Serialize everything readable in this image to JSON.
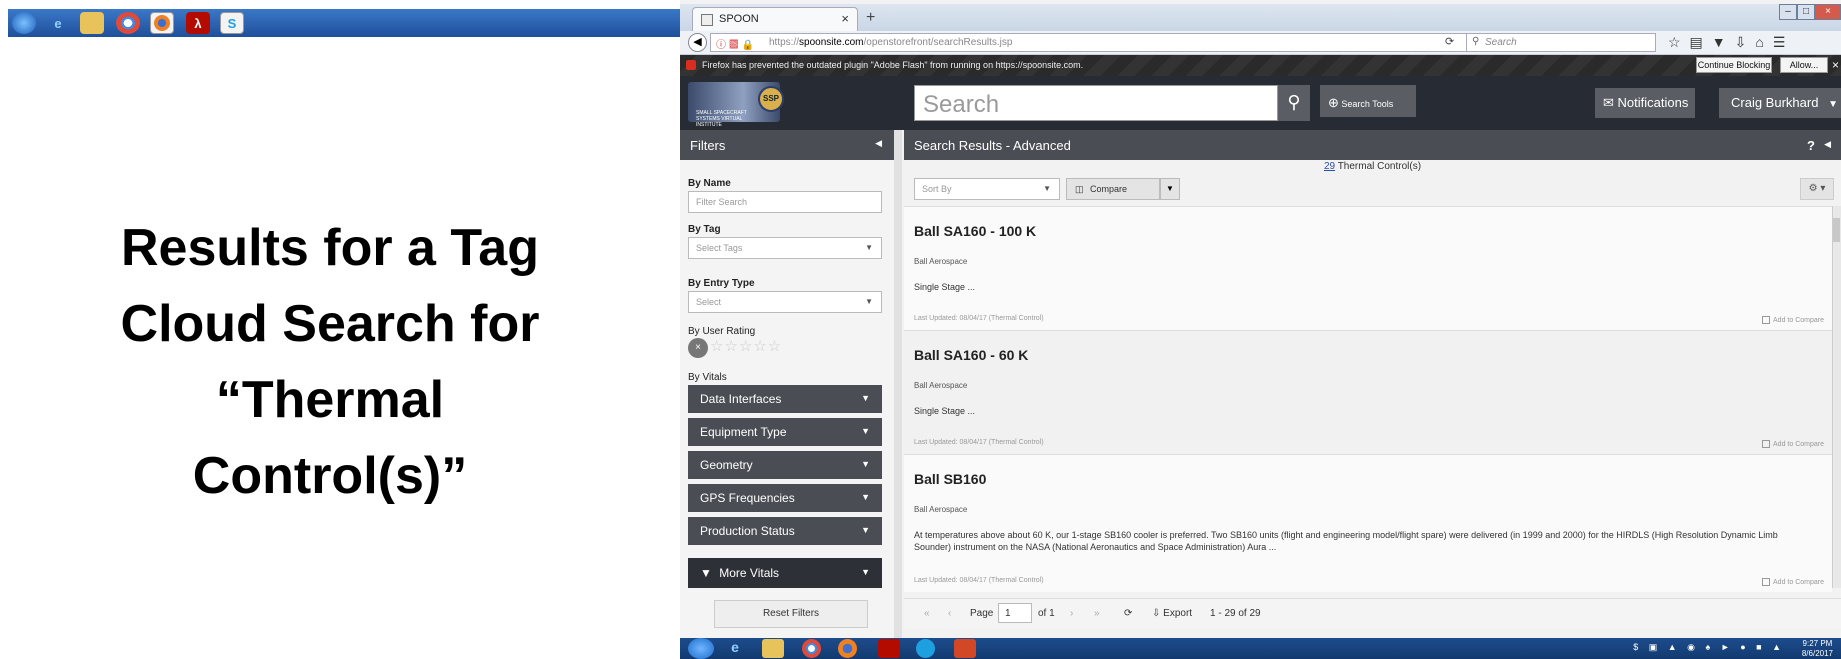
{
  "slide": {
    "title_lines": [
      "Results for a Tag",
      "Cloud Search for",
      "“Thermal",
      "Control(s)”"
    ]
  },
  "browser": {
    "tab_title": "SPOON",
    "url_prefix": "https://",
    "url_domain": "spoonsite.com",
    "url_path": "/openstorefront/searchResults.jsp",
    "search_placeholder": "Search",
    "flash_message": "Firefox has prevented the outdated plugin \"Adobe Flash\" from running on https://spoonsite.com.",
    "continue_blocking": "Continue Blocking",
    "allow": "Allow..."
  },
  "header": {
    "logo_text": "SMALL SPACECRAFT SYSTEMS VIRTUAL INSTITUTE",
    "logo_badge": "SSP",
    "search_placeholder": "Search",
    "search_tools": "Search Tools",
    "notifications": "Notifications",
    "user_name": "Craig Burkhard"
  },
  "filters": {
    "title": "Filters",
    "by_name": "By Name",
    "name_placeholder": "Filter Search",
    "by_tag": "By Tag",
    "tag_placeholder": "Select Tags",
    "by_entry_type": "By Entry Type",
    "entry_placeholder": "Select",
    "by_user_rating": "By User Rating",
    "by_vitals": "By Vitals",
    "vitals": [
      "Data Interfaces",
      "Equipment Type",
      "Geometry",
      "GPS Frequencies",
      "Production Status"
    ],
    "more_vitals": "More Vitals",
    "reset": "Reset Filters"
  },
  "results": {
    "title": "Search Results - Advanced",
    "count": "29",
    "count_label": "Thermal Control(s)",
    "sort_placeholder": "Sort By",
    "compare": "Compare",
    "add_to_compare": "Add to Compare",
    "items": [
      {
        "title": "Ball SA160 - 100 K",
        "org": "Ball Aerospace",
        "desc": "Single Stage ...",
        "updated": "Last Updated: 08/04/17 (Thermal Control)"
      },
      {
        "title": "Ball SA160 - 60 K",
        "org": "Ball Aerospace",
        "desc": "Single Stage ...",
        "updated": "Last Updated: 08/04/17 (Thermal Control)"
      },
      {
        "title": "Ball SB160",
        "org": "Ball Aerospace",
        "desc": "At temperatures above about 60 K, our 1-stage SB160 cooler is preferred. Two SB160 units (flight and engineering model/flight spare) were delivered (in 1999 and 2000) for the HIRDLS (High Resolution Dynamic Limb Sounder) instrument on the NASA (National Aeronautics and Space Administration) Aura ...",
        "updated": "Last Updated: 08/04/17 (Thermal Control)"
      }
    ],
    "pager": {
      "page_label": "Page",
      "page_value": "1",
      "of_label": "of 1",
      "export": "Export",
      "range": "1 - 29 of 29"
    }
  },
  "taskbar": {
    "time": "9:27 PM",
    "date": "8/6/2017"
  }
}
